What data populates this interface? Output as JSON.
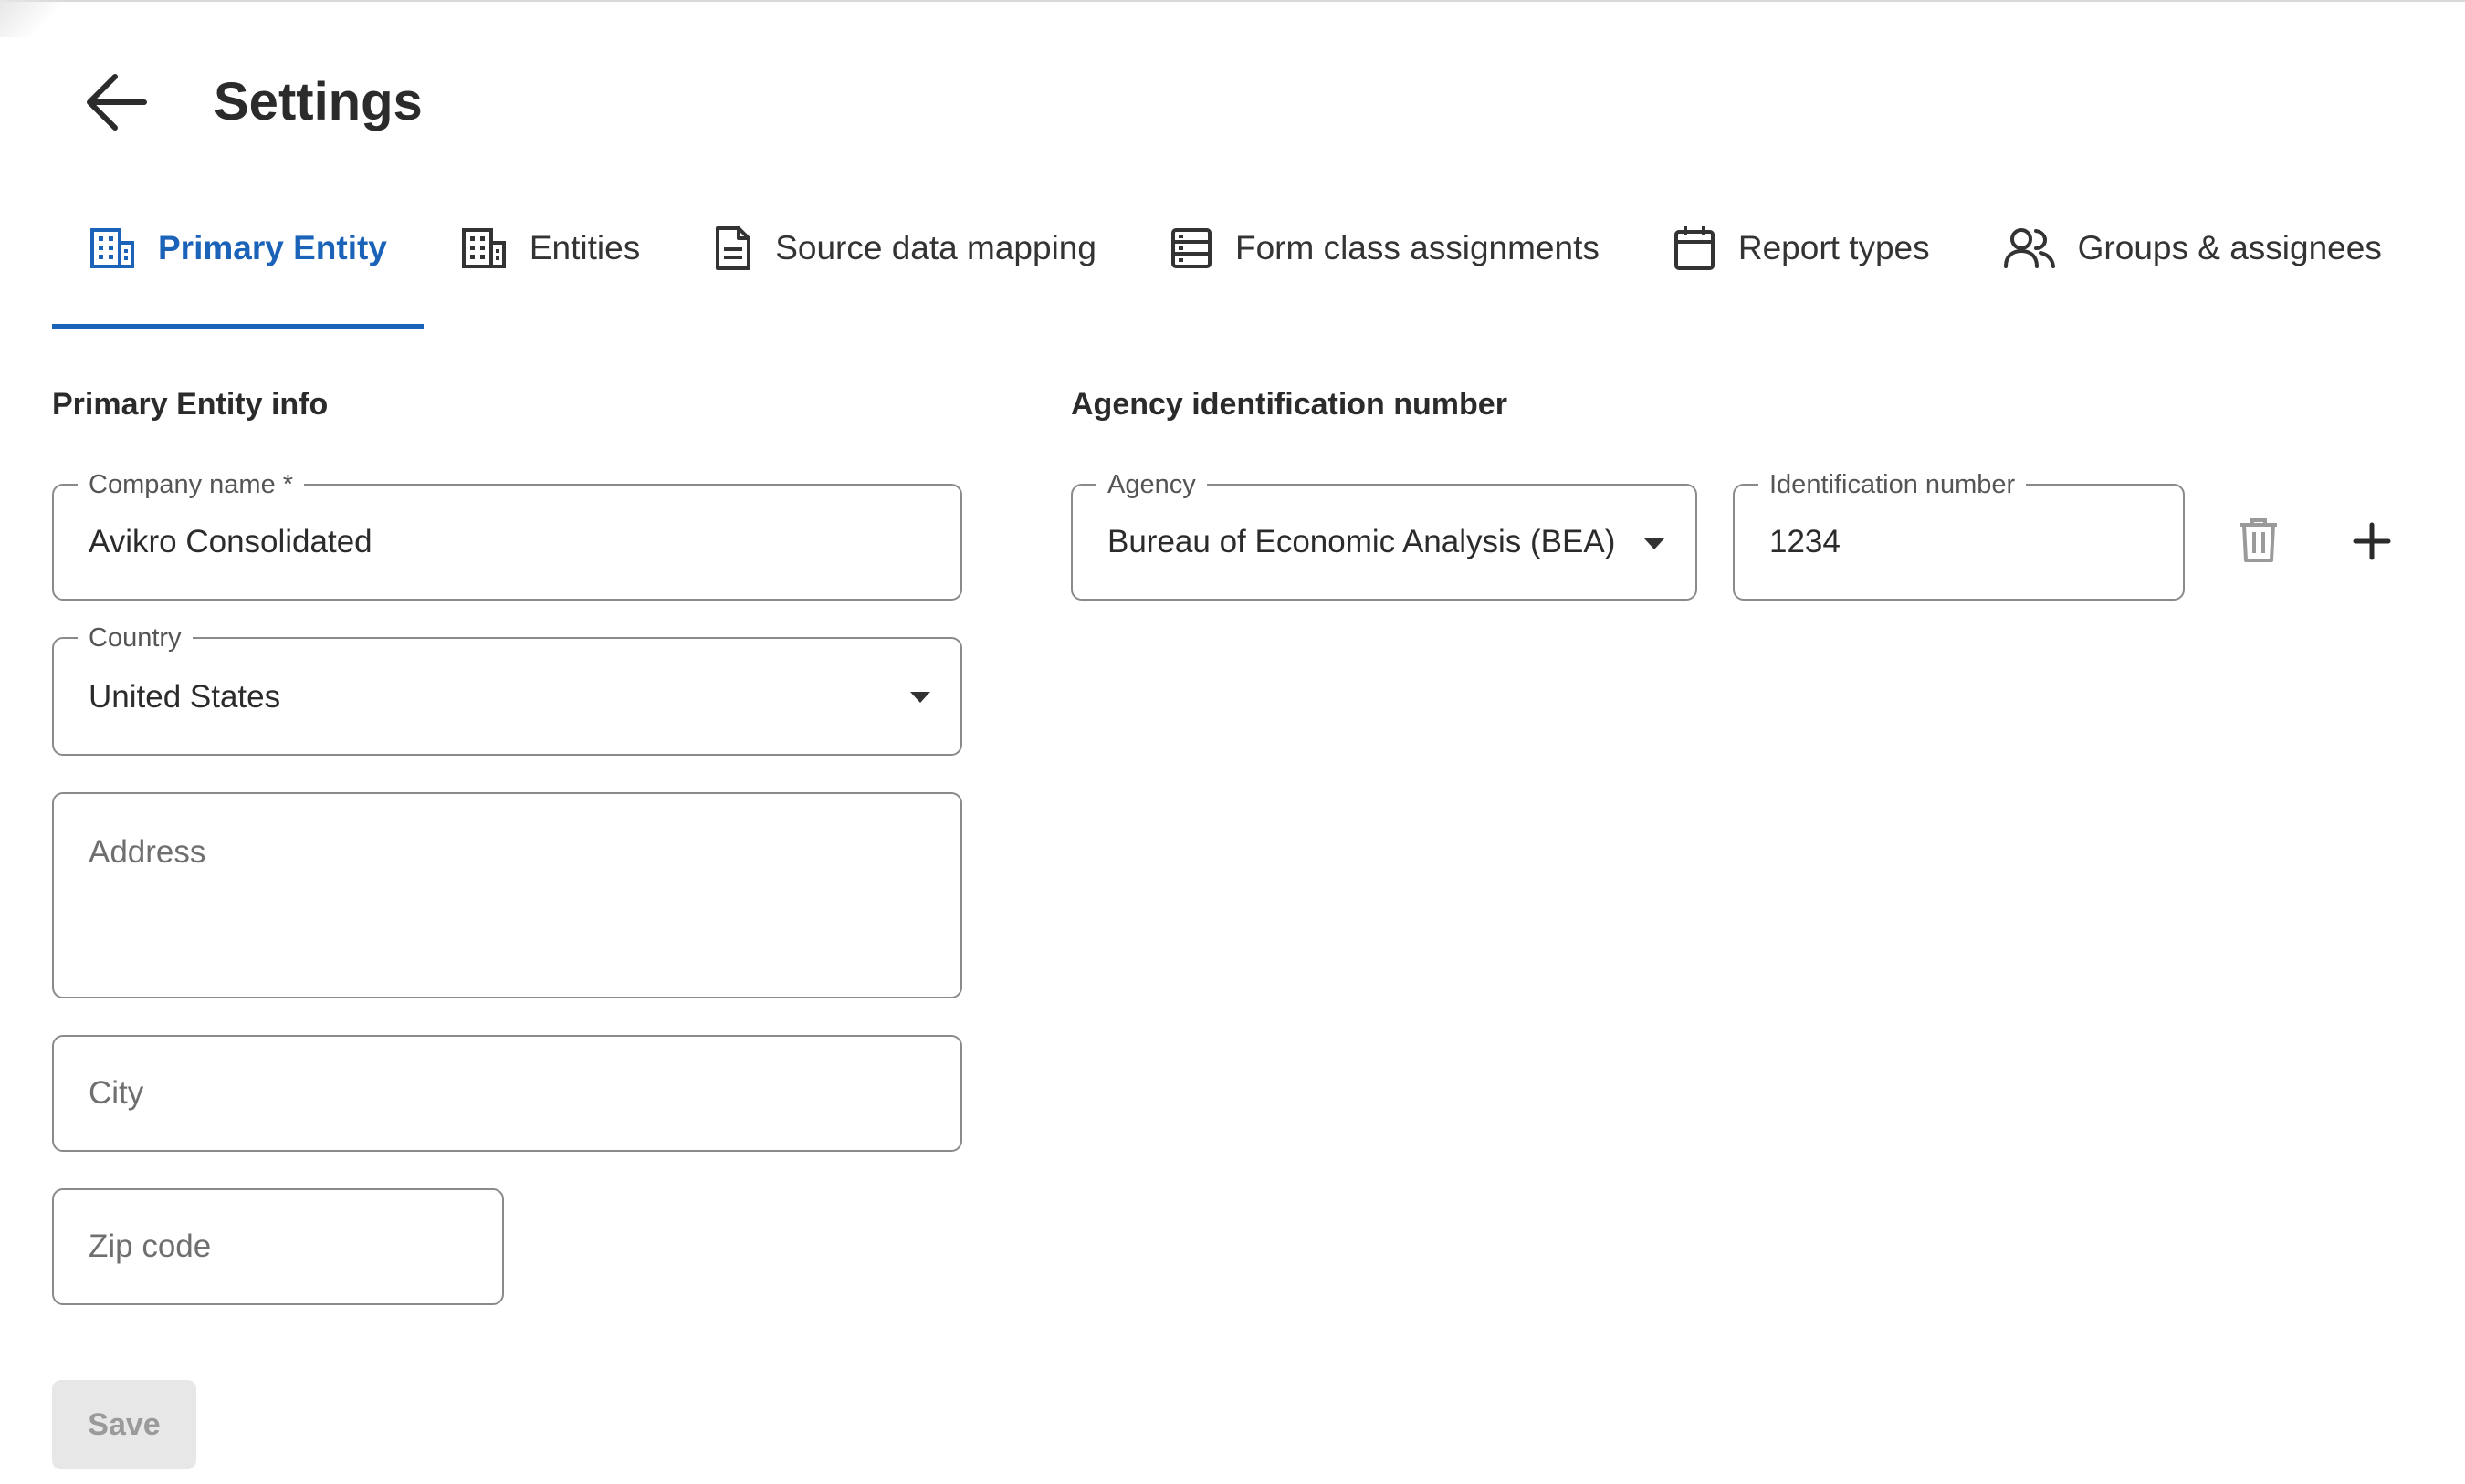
{
  "header": {
    "title": "Settings"
  },
  "tabs": [
    {
      "label": "Primary Entity",
      "icon": "building-icon",
      "active": true
    },
    {
      "label": "Entities",
      "icon": "building-icon",
      "active": false
    },
    {
      "label": "Source data mapping",
      "icon": "document-icon",
      "active": false
    },
    {
      "label": "Form class assignments",
      "icon": "list-icon",
      "active": false
    },
    {
      "label": "Report types",
      "icon": "calendar-icon",
      "active": false
    },
    {
      "label": "Groups & assignees",
      "icon": "users-icon",
      "active": false
    }
  ],
  "primary_entity": {
    "section_title": "Primary Entity info",
    "company_name": {
      "label": "Company name *",
      "value": "Avikro Consolidated"
    },
    "country": {
      "label": "Country",
      "value": "United States"
    },
    "address": {
      "placeholder": "Address"
    },
    "city": {
      "placeholder": "City"
    },
    "zip": {
      "placeholder": "Zip code"
    }
  },
  "agency_section": {
    "section_title": "Agency identification number",
    "agency": {
      "label": "Agency",
      "value": "Bureau of Economic Analysis (BEA)"
    },
    "identification_number": {
      "label": "Identification number",
      "value": "1234"
    }
  },
  "actions": {
    "save_label": "Save"
  },
  "colors": {
    "accent": "#1a63b8",
    "border": "#8a8a8a",
    "disabled_bg": "#e7e7e7",
    "disabled_text": "#9a9a9a"
  }
}
